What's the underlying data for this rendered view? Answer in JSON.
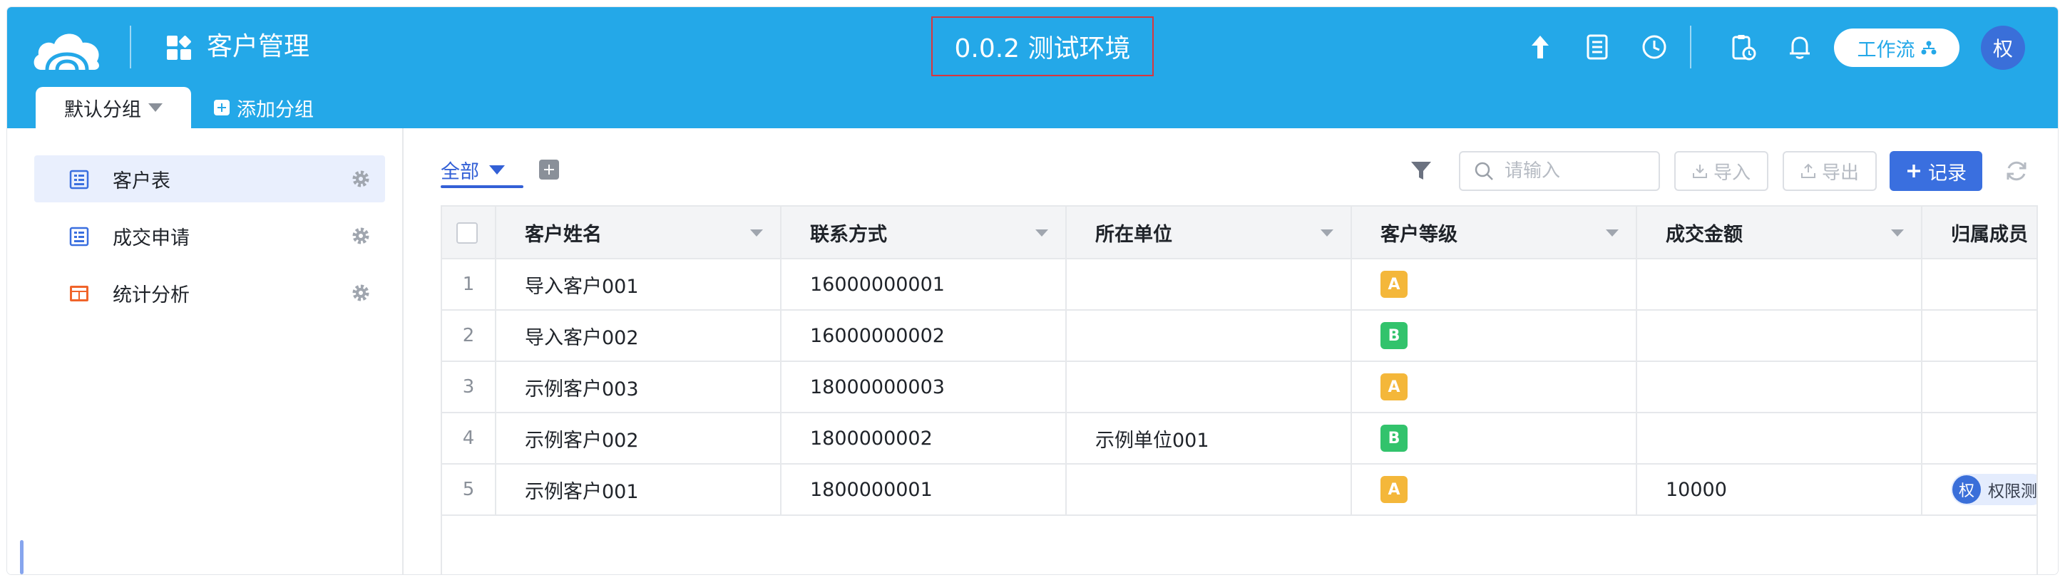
{
  "header": {
    "app_title": "客户管理",
    "env_label": "0.0.2 测试环境",
    "workflow_label": "工作流",
    "avatar_text": "权",
    "accent_color": "#24a8e8"
  },
  "groups": {
    "active_tab": "默认分组",
    "add_label": "添加分组"
  },
  "sidebar": {
    "items": [
      {
        "label": "客户表",
        "icon": "form-icon",
        "active": true
      },
      {
        "label": "成交申请",
        "icon": "form-icon",
        "active": false
      },
      {
        "label": "统计分析",
        "icon": "dashboard-icon",
        "active": false
      }
    ]
  },
  "toolbar": {
    "view_label": "全部",
    "search_placeholder": "请输入",
    "import_label": "导入",
    "export_label": "导出",
    "record_label": "记录",
    "primary_color": "#3a6fdf"
  },
  "table": {
    "columns": [
      "客户姓名",
      "联系方式",
      "所在单位",
      "客户等级",
      "成交金额",
      "归属成员"
    ],
    "rows": [
      {
        "index": "1",
        "name": "导入客户001",
        "contact": "16000000001",
        "company": "",
        "level": "A",
        "amount": "",
        "member": ""
      },
      {
        "index": "2",
        "name": "导入客户002",
        "contact": "16000000002",
        "company": "",
        "level": "B",
        "amount": "",
        "member": ""
      },
      {
        "index": "3",
        "name": "示例客户003",
        "contact": "18000000003",
        "company": "",
        "level": "A",
        "amount": "",
        "member": ""
      },
      {
        "index": "4",
        "name": "示例客户002",
        "contact": "1800000002",
        "company": "示例单位001",
        "level": "B",
        "amount": "",
        "member": ""
      },
      {
        "index": "5",
        "name": "示例客户001",
        "contact": "1800000001",
        "company": "",
        "level": "A",
        "amount": "10000",
        "member": "权限测",
        "member_avatar": "权"
      }
    ],
    "level_colors": {
      "A": "#f4b73a",
      "B": "#32c36c"
    }
  }
}
